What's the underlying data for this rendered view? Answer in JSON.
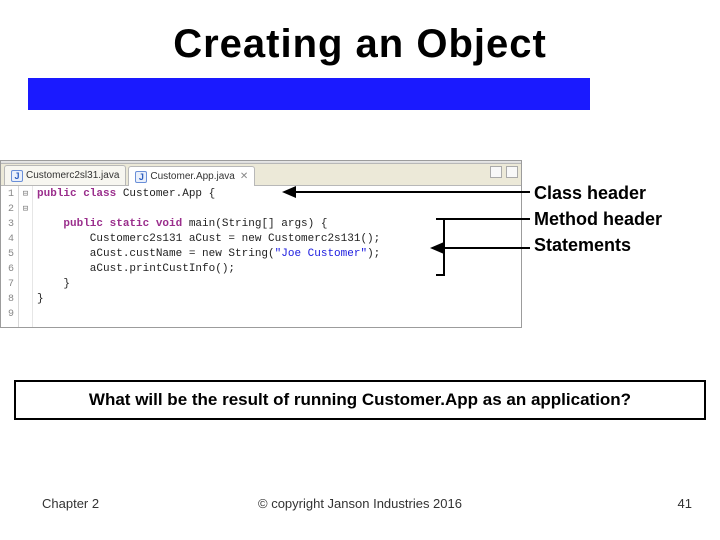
{
  "title": "Creating an Object",
  "editor": {
    "tabs": [
      {
        "icon": "J",
        "label": "Customerc2sl31.java",
        "active": false
      },
      {
        "icon": "J",
        "label": "Customer.App.java",
        "active": true
      }
    ],
    "lineCount": 9,
    "fold": {
      "1": "⊟",
      "3": "⊟"
    },
    "code": {
      "l1": {
        "kw": "public class",
        "rest": " Customer.App {"
      },
      "l2": "",
      "l3": {
        "kw": "public static void",
        "rest": " main(String[] args) {"
      },
      "l4": "        Customerc2s131 aCust = new Customerc2s131();",
      "l5a": "        aCust.custName = new String(",
      "l5s": "\"Joe Customer\"",
      "l5b": ");",
      "l6": "        aCust.printCustInfo();",
      "l7": "    }",
      "l8": "}",
      "l9": ""
    }
  },
  "labels": {
    "class": "Class header",
    "method": "Method header",
    "statements": "Statements"
  },
  "question": "What will be the result of running Customer.App as an application?",
  "footer": {
    "left": "Chapter 2",
    "center": "© copyright Janson Industries 2016",
    "right": "41"
  }
}
